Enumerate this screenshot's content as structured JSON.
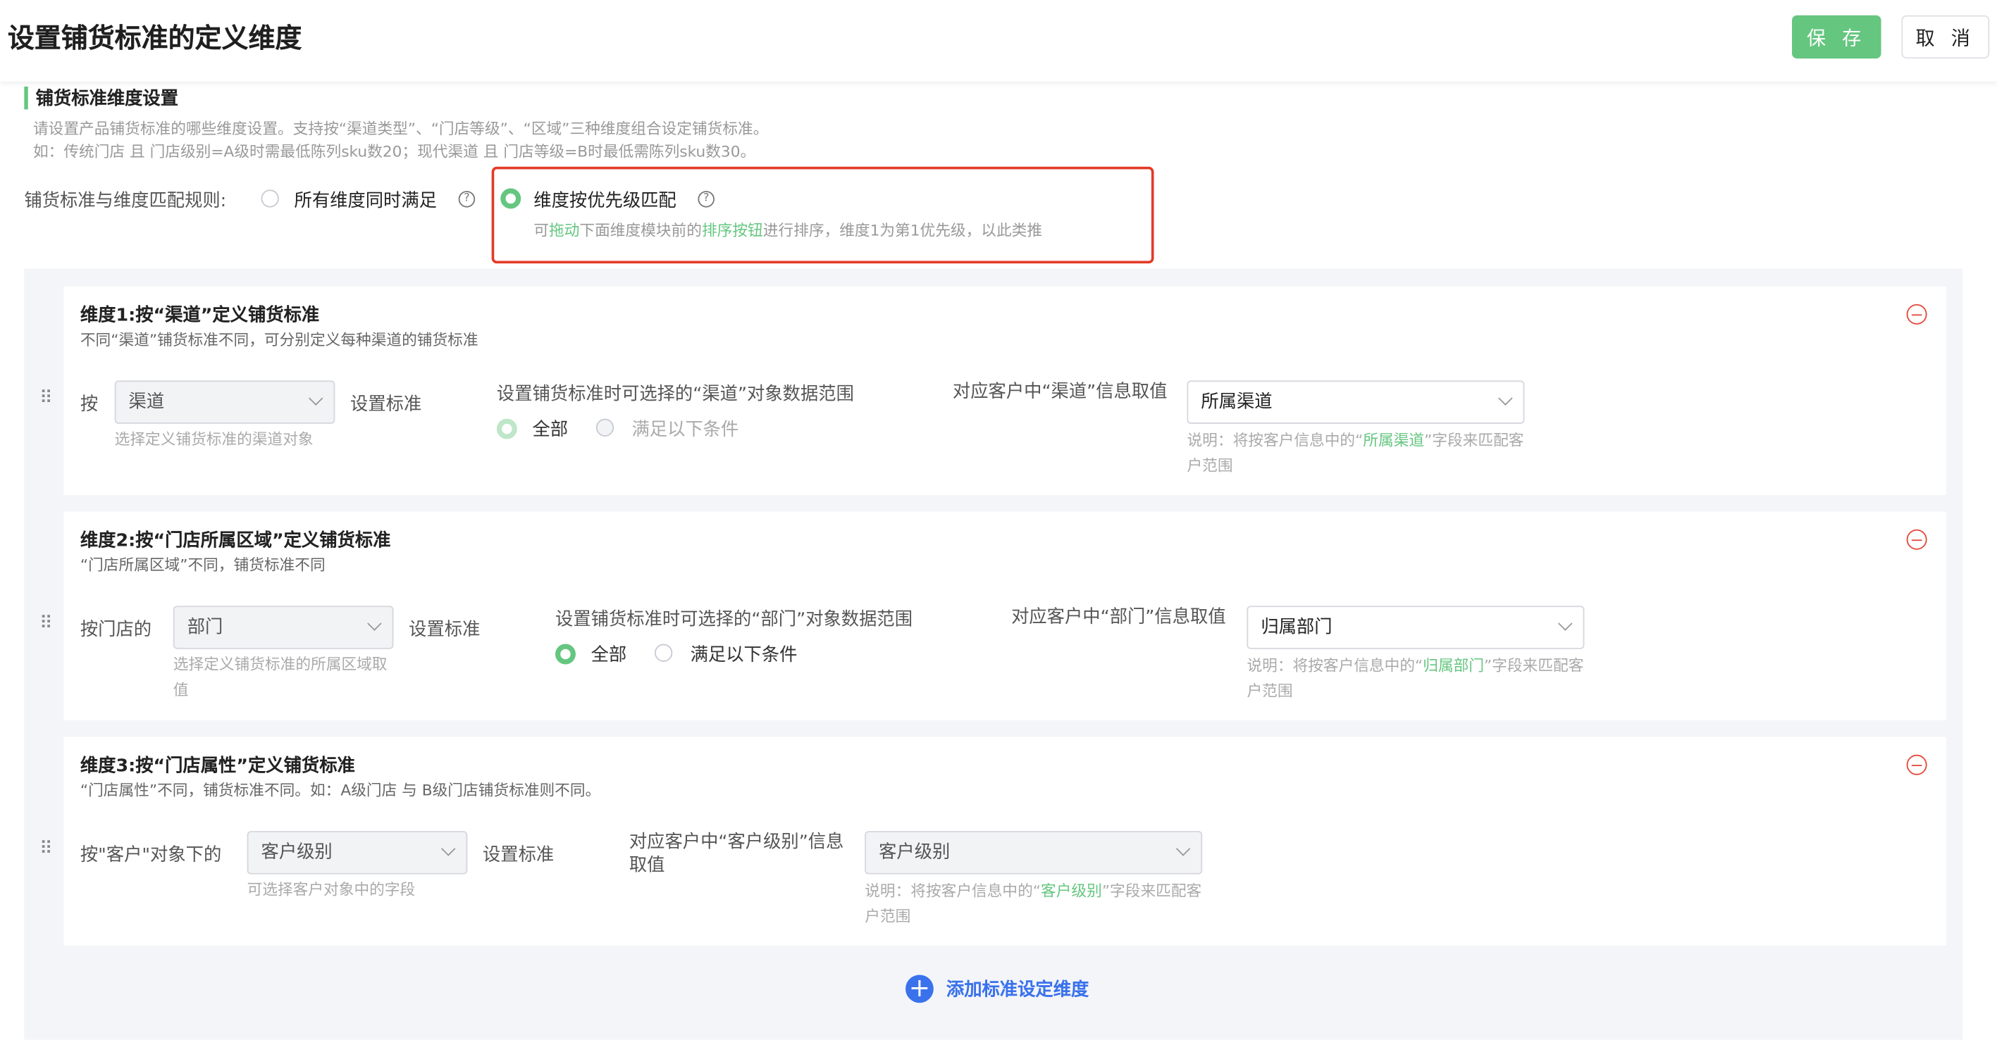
{
  "header": {
    "title": "设置铺货标准的定义维度",
    "save_label": "保 存",
    "cancel_label": "取 消"
  },
  "section": {
    "title": "铺货标准维度设置",
    "desc1": "请设置产品铺货标准的哪些维度设置。支持按“渠道类型”、“门店等级”、“区域”三种维度组合设定铺货标准。",
    "desc2": "如：传统门店 且 门店级别=A级时需最低陈列sku数20；现代渠道 且 门店等级=B时最低需陈列sku数30。"
  },
  "rule": {
    "label": "铺货标准与维度匹配规则:",
    "option1": "所有维度同时满足",
    "option2": "维度按优先级匹配",
    "hint_pre": "可",
    "hint_drag": "拖动",
    "hint_mid": "下面维度模块前的",
    "hint_btn": "排序按钮",
    "hint_post": "进行排序，维度1为第1优先级，以此类推",
    "help": "?"
  },
  "cards": [
    {
      "title": "维度1:按“渠道”定义铺货标准",
      "subtitle": "不同“渠道”铺货标准不同，可分别定义每种渠道的铺货标准",
      "prefix": "按",
      "select": "渠道",
      "set_label": "设置标准",
      "select_hint": "选择定义铺货标准的渠道对象",
      "range_label": "设置铺货标准时可选择的“渠道”对象数据范围",
      "range_all": "全部",
      "range_cond": "满足以下条件",
      "map_label": "对应客户中“渠道”信息取值",
      "map_select": "所属渠道",
      "note_pre": "说明：将按客户信息中的“",
      "note_field": "所属渠道",
      "note_post": "”字段来匹配客户范围"
    },
    {
      "title": "维度2:按“门店所属区域”定义铺货标准",
      "subtitle": "“门店所属区域”不同，铺货标准不同",
      "prefix": "按门店的",
      "select": "部门",
      "set_label": "设置标准",
      "select_hint": "选择定义铺货标准的所属区域取值",
      "range_label": "设置铺货标准时可选择的“部门”对象数据范围",
      "range_all": "全部",
      "range_cond": "满足以下条件",
      "map_label": "对应客户中“部门”信息取值",
      "map_select": "归属部门",
      "note_pre": "说明：将按客户信息中的“",
      "note_field": "归属部门",
      "note_post": "”字段来匹配客户范围"
    },
    {
      "title": "维度3:按“门店属性”定义铺货标准",
      "subtitle": "“门店属性”不同，铺货标准不同。如：A级门店 与 B级门店铺货标准则不同。",
      "prefix": "按\"客户\"对象下的",
      "select": "客户级别",
      "set_label": "设置标准",
      "select_hint": "可选择客户对象中的字段",
      "map_label": "对应客户中“客户级别”信息取值",
      "map_select": "客户级别",
      "note_pre": "说明：将按客户信息中的“",
      "note_field": "客户级别",
      "note_post": "”字段来匹配客户范围"
    }
  ],
  "add_label": "添加标准设定维度",
  "colors": {
    "accent": "#65c680",
    "danger": "#e33a26",
    "link": "#3a72ec"
  }
}
